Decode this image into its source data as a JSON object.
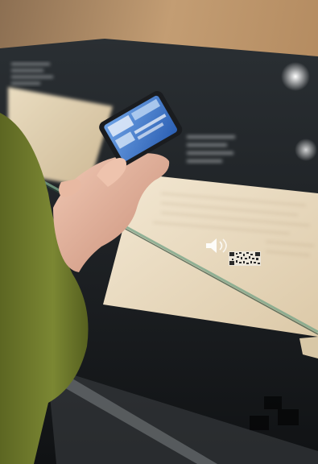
{
  "scene": {
    "description_tags": [
      "photo",
      "museum-display-case",
      "hand",
      "smartphone",
      "qr-code",
      "audio-icon"
    ],
    "colors": {
      "wood": "#b9936b",
      "case_dark": "#1c1f22",
      "paper": "#e9dcc4",
      "sleeve": "#6f7a2c",
      "skin": "#e3b7a2",
      "phone_screen": "#3f74c9",
      "glass_edge": "#5f8f6a"
    }
  },
  "icons": {
    "audio": "speaker-wave-icon",
    "qr": "qr-code-icon"
  }
}
